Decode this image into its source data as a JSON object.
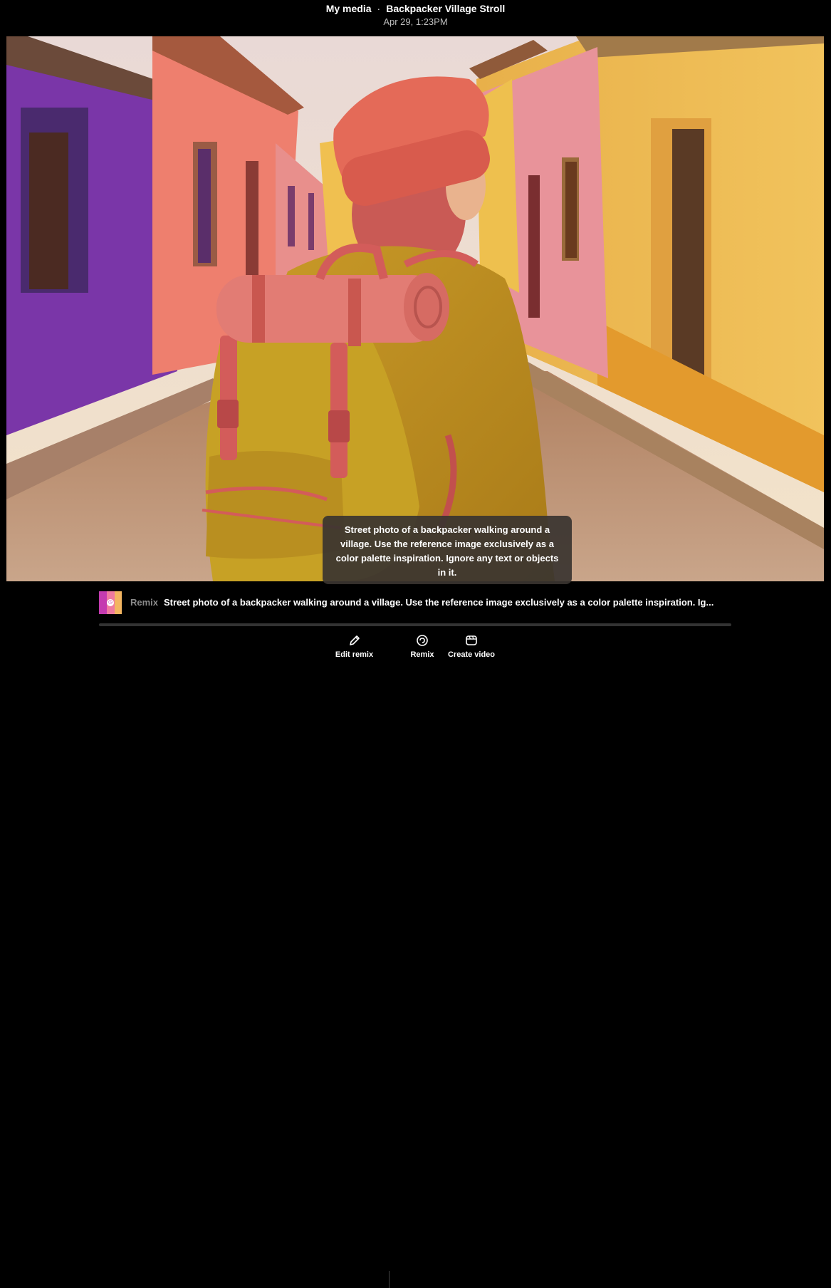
{
  "header": {
    "collection": "My media",
    "separator": "·",
    "title": "Backpacker Village Stroll",
    "timestamp": "Apr 29, 1:23PM"
  },
  "image": {
    "tooltip": "Street photo of a backpacker walking around a village. Use the reference image exclusively as a color palette inspiration. Ignore any text or objects in it."
  },
  "remix": {
    "thumbnail_colors": [
      "#c43bb0",
      "#ef7aa0",
      "#f3b561"
    ],
    "label": "Remix",
    "prompt": "Street photo of a backpacker walking around a village. Use the reference image exclusively as a color palette inspiration. Ig..."
  },
  "actions": [
    {
      "label": "Edit remix",
      "icon": "pencil-icon"
    },
    {
      "label": "Remix",
      "icon": "remix-icon"
    },
    {
      "label": "Create video",
      "icon": "video-icon"
    }
  ]
}
